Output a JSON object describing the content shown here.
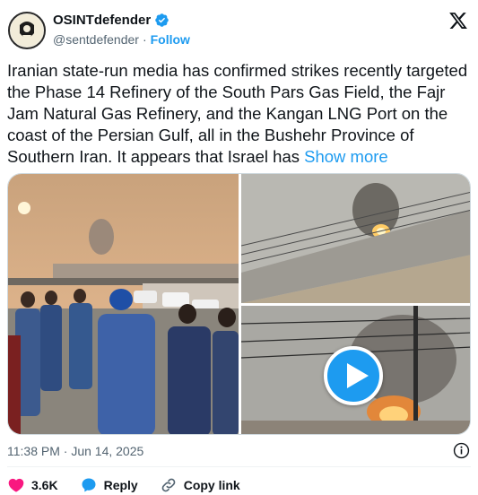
{
  "author": {
    "display_name": "OSINTdefender",
    "handle": "@sentdefender",
    "separator": "·",
    "follow_label": "Follow",
    "verified": true
  },
  "tweet": {
    "text": "Iranian state-run media has confirmed strikes recently targeted the Phase 14 Refinery of the South Pars Gas Field, the Fajr Jam Natural Gas Refinery, and the Kangan LNG Port on the coast of the Persian Gulf, all in the Bushehr Province of Southern Iran. It appears that Israel has",
    "show_more_label": "Show more"
  },
  "media": {
    "items": [
      {
        "kind": "photo",
        "icon": "crowd-watching-smoke"
      },
      {
        "kind": "photo",
        "icon": "fire-behind-wall"
      },
      {
        "kind": "video",
        "icon": "fire-under-power-lines"
      }
    ],
    "play_icon": "play-icon"
  },
  "footer": {
    "timestamp": "11:38 PM · Jun 14, 2025",
    "like_count": "3.6K",
    "reply_label": "Reply",
    "copy_link_label": "Copy link"
  },
  "colors": {
    "accent": "#1d9bf0",
    "like": "#f91880",
    "text_secondary": "#536471"
  }
}
